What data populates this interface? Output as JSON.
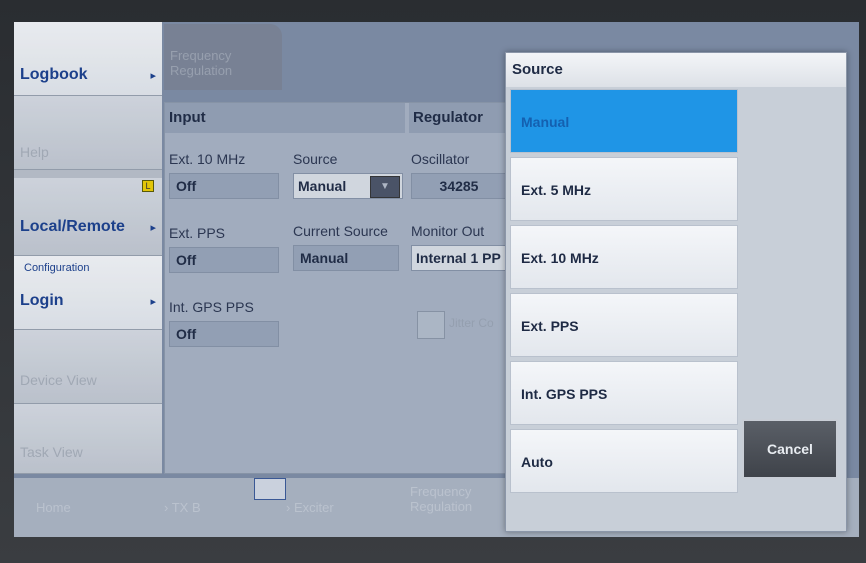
{
  "sidebar": {
    "items": [
      {
        "label": "Logbook",
        "arrow": "▸"
      },
      {
        "label": "Help"
      },
      {
        "label": "Local/Remote",
        "arrow": "▸",
        "badge": "L"
      },
      {
        "sublabel": "Configuration",
        "label": "Login",
        "arrow": "▸"
      },
      {
        "label": "Device View"
      },
      {
        "label": "Task View"
      }
    ]
  },
  "tab": {
    "label": "Frequency Regulation"
  },
  "input_section": {
    "title": "Input",
    "ext10_label": "Ext. 10 MHz",
    "ext10_value": "Off",
    "source_label": "Source",
    "source_value": "Manual",
    "extpps_label": "Ext. PPS",
    "extpps_value": "Off",
    "current_source_label": "Current Source",
    "current_source_value": "Manual",
    "intgps_label": "Int. GPS PPS",
    "intgps_value": "Off"
  },
  "regulator_section": {
    "title": "Regulator",
    "oscillator_label": "Oscillator",
    "oscillator_value": "34285",
    "monitor_label": "Monitor Out",
    "monitor_value": "Internal 1 PP",
    "jitter_label": "Jitter Co"
  },
  "bottom_bar": {
    "home": "Home",
    "txb": "TX B",
    "exciter": "Exciter",
    "freq_reg": "Frequency Regulation"
  },
  "dialog": {
    "title": "Source",
    "options": [
      "Manual",
      "Ext. 5 MHz",
      "Ext. 10 MHz",
      "Ext. PPS",
      "Int. GPS PPS",
      "Auto"
    ],
    "selected": "Manual",
    "cancel": "Cancel"
  }
}
